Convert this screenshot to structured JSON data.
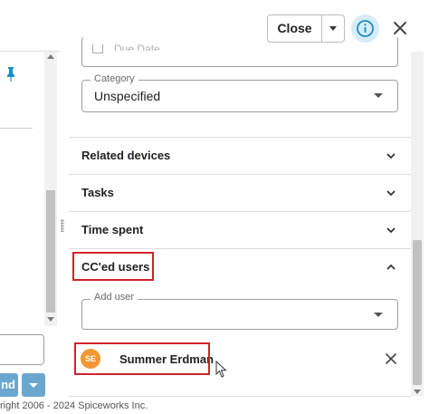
{
  "header": {
    "close_label": "Close"
  },
  "left_pane": {
    "button_partial_label": "nd",
    "copyright": "right 2006 - 2024 Spiceworks Inc."
  },
  "fields": {
    "due_date_label": "Due Date",
    "category_label": "Category",
    "category_value": "Unspecified",
    "add_user_label": "Add user",
    "add_user_value": ""
  },
  "sections": [
    {
      "title": "Related devices",
      "state": "collapsed"
    },
    {
      "title": "Tasks",
      "state": "collapsed"
    },
    {
      "title": "Time spent",
      "state": "collapsed"
    },
    {
      "title": "CC'ed users",
      "state": "expanded"
    }
  ],
  "cc_users": [
    {
      "initials": "SE",
      "name": "Summer Erdman"
    }
  ],
  "colors": {
    "accent": "#1a8fc7",
    "info_bg": "#d6ecf6",
    "avatar": "#f39633",
    "highlight": "#d0232b",
    "button_blue": "#6aa7cf"
  }
}
